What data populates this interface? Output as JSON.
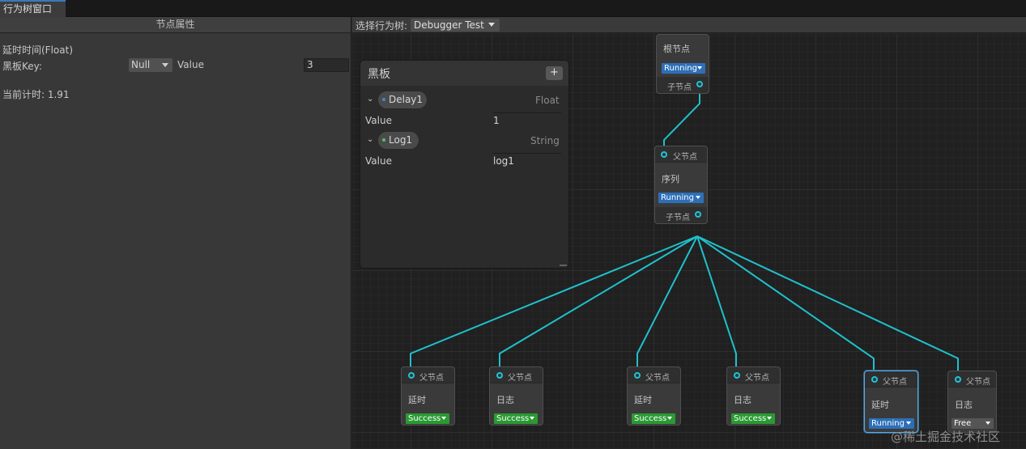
{
  "window": {
    "tab_title": "行为树窗口"
  },
  "properties_panel": {
    "header": "节点属性",
    "field_title": "延时时间(Float)",
    "bb_key_label": "黑板Key:",
    "bb_key_value": "Null",
    "value_label": "Value",
    "value": "3",
    "timer_text": "当前计时: 1.91"
  },
  "graph_header": {
    "select_label": "选择行为树:",
    "selected_tree": "Debugger Test"
  },
  "blackboard": {
    "title": "黑板",
    "add_label": "+",
    "chevron": "⌄",
    "entries": [
      {
        "name": "Delay1",
        "type": "Float",
        "value_label": "Value",
        "value": "1",
        "dot_color": "#3f86d6"
      },
      {
        "name": "Log1",
        "type": "String",
        "value_label": "Value",
        "value": "log1",
        "dot_color": "#49c66a"
      }
    ]
  },
  "colors": {
    "edge": "#1fc0cc",
    "running": "#2d6fb8",
    "success": "#2a9a33",
    "free": "#555555"
  },
  "nodes": {
    "root": {
      "title": "根节点",
      "status": "Running",
      "child_port": "子节点"
    },
    "sequence": {
      "parent_port": "父节点",
      "title": "序列",
      "status": "Running",
      "child_port": "子节点"
    },
    "leaves": [
      {
        "parent_port": "父节点",
        "title": "延时",
        "status": "Success"
      },
      {
        "parent_port": "父节点",
        "title": "日志",
        "status": "Success"
      },
      {
        "parent_port": "父节点",
        "title": "延时",
        "status": "Success"
      },
      {
        "parent_port": "父节点",
        "title": "日志",
        "status": "Success"
      },
      {
        "parent_port": "父节点",
        "title": "延时",
        "status": "Running"
      },
      {
        "parent_port": "父节点",
        "title": "日志",
        "status": "Free"
      }
    ]
  },
  "watermark": "@稀土掘金技术社区"
}
